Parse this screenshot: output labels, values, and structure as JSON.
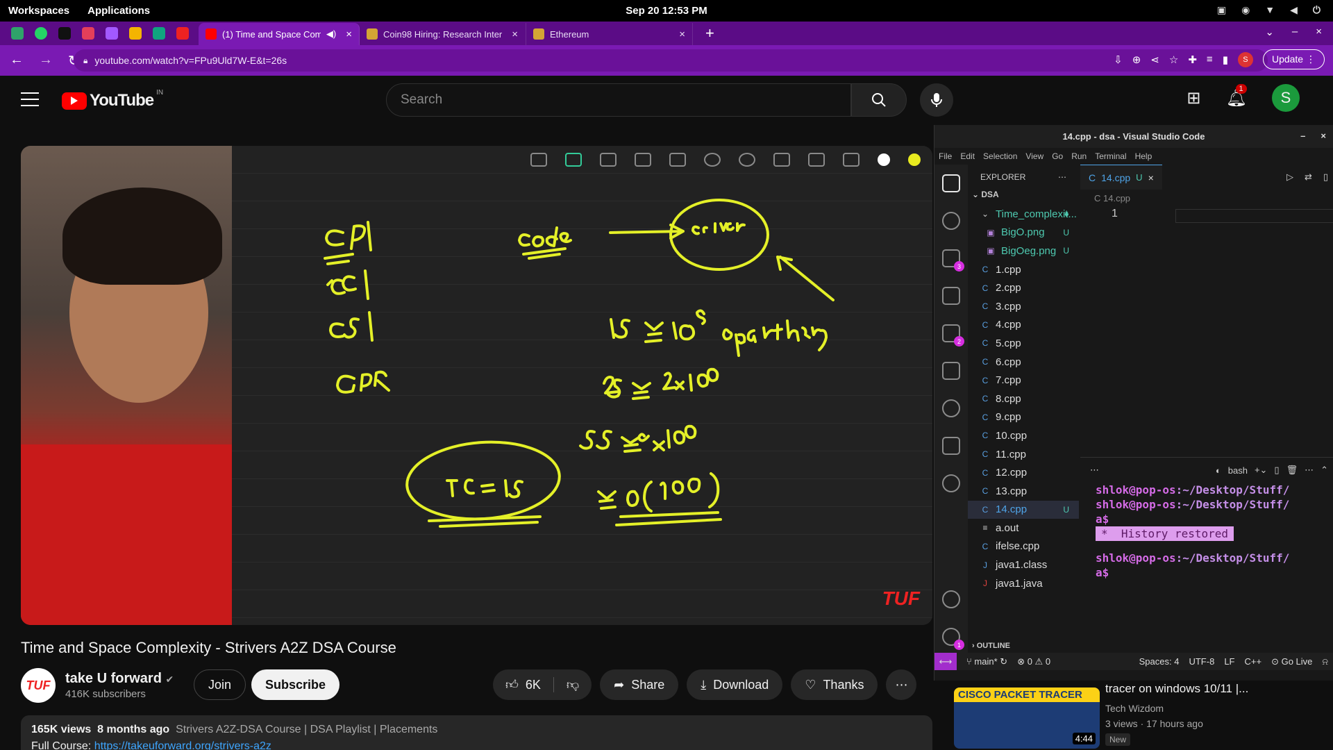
{
  "desktop": {
    "workspaces": "Workspaces",
    "applications": "Applications",
    "datetime": "Sep 20  12:53 PM"
  },
  "browser": {
    "tabs": [
      {
        "title": "(1) Time and Space Compl",
        "favicon": "youtube-icon",
        "active": true
      },
      {
        "title": "Coin98 Hiring: Research Inter",
        "favicon": "coin98-icon",
        "active": false
      },
      {
        "title": "Ethereum",
        "favicon": "coin98-icon",
        "active": false
      }
    ],
    "url": "youtube.com/watch?v=FPu9Uld7W-E&t=26s",
    "update_label": "Update",
    "profile_initial": "S",
    "accent": "#7a1ab3"
  },
  "youtube": {
    "logo_text": "YouTube",
    "country": "IN",
    "search_placeholder": "Search",
    "notifications": "1",
    "avatar_initial": "S",
    "video": {
      "title": "Time and Space Complexity - Strivers A2Z DSA Course",
      "watermark": "TUF"
    },
    "channel": {
      "name": "take U forward",
      "subscribers": "416K subscribers",
      "avatar_text": "TUF"
    },
    "join": "Join",
    "subscribe": "Subscribe",
    "likes": "6K",
    "share": "Share",
    "download": "Download",
    "thanks": "Thanks",
    "description": {
      "views": "165K views",
      "age": "8 months ago",
      "tags": "Strivers A2Z-DSA Course | DSA Playlist | Placements",
      "full_course_label": "Full Course:",
      "link": "https://takeuforward.org/strivers-a2z"
    },
    "recommendation": {
      "thumb_text": "CISCO PACKET TRACER",
      "duration": "4:44",
      "title": "tracer on windows 10/11 |...",
      "channel": "Tech Wizdom",
      "meta": "3 views  ·  17 hours ago",
      "badge": "New"
    }
  },
  "vscode": {
    "window_title": "14.cpp - dsa - Visual Studio Code",
    "menu": [
      "File",
      "Edit",
      "Selection",
      "View",
      "Go",
      "Run",
      "Terminal",
      "Help"
    ],
    "explorer_label": "EXPLORER",
    "root_folder": "DSA",
    "files": [
      {
        "name": "Time_complexit...",
        "icon": "folder-open",
        "badge": "●",
        "indent": 1
      },
      {
        "name": "BigO.png",
        "icon": "image",
        "badge": "U",
        "indent": 2
      },
      {
        "name": "BigOeg.png",
        "icon": "image",
        "badge": "U",
        "indent": 2
      },
      {
        "name": "1.cpp",
        "icon": "cpp",
        "badge": "",
        "indent": 1
      },
      {
        "name": "2.cpp",
        "icon": "cpp",
        "badge": "",
        "indent": 1
      },
      {
        "name": "3.cpp",
        "icon": "cpp",
        "badge": "",
        "indent": 1
      },
      {
        "name": "4.cpp",
        "icon": "cpp",
        "badge": "",
        "indent": 1
      },
      {
        "name": "5.cpp",
        "icon": "cpp",
        "badge": "",
        "indent": 1
      },
      {
        "name": "6.cpp",
        "icon": "cpp",
        "badge": "",
        "indent": 1
      },
      {
        "name": "7.cpp",
        "icon": "cpp",
        "badge": "",
        "indent": 1
      },
      {
        "name": "8.cpp",
        "icon": "cpp",
        "badge": "",
        "indent": 1
      },
      {
        "name": "9.cpp",
        "icon": "cpp",
        "badge": "",
        "indent": 1
      },
      {
        "name": "10.cpp",
        "icon": "cpp",
        "badge": "",
        "indent": 1
      },
      {
        "name": "11.cpp",
        "icon": "cpp",
        "badge": "",
        "indent": 1
      },
      {
        "name": "12.cpp",
        "icon": "cpp",
        "badge": "",
        "indent": 1
      },
      {
        "name": "13.cpp",
        "icon": "cpp",
        "badge": "",
        "indent": 1
      },
      {
        "name": "14.cpp",
        "icon": "cpp",
        "badge": "U",
        "indent": 1,
        "selected": true
      },
      {
        "name": "a.out",
        "icon": "binary",
        "badge": "",
        "indent": 1
      },
      {
        "name": "ifelse.cpp",
        "icon": "cpp",
        "badge": "",
        "indent": 1
      },
      {
        "name": "java1.class",
        "icon": "java-class",
        "badge": "",
        "indent": 1
      },
      {
        "name": "java1.java",
        "icon": "java",
        "badge": "",
        "indent": 1
      }
    ],
    "outline_label": "OUTLINE",
    "editor_tab": "14.cpp",
    "editor_tab_badge": "U",
    "breadcrumb": "14.cpp",
    "line_number": "1",
    "terminal_name": "bash",
    "terminal_lines": [
      {
        "prompt": "shlok@pop-os",
        "path": ":~/Desktop/Stuff/"
      },
      {
        "prompt": "shlok@pop-os",
        "path": ":~/Desktop/Stuff/"
      },
      {
        "prompt": "a$",
        "path": ""
      }
    ],
    "history_restored": "History restored",
    "history_prefix": "*",
    "terminal_lines_after": [
      {
        "prompt": "shlok@pop-os",
        "path": ":~/Desktop/Stuff/"
      },
      {
        "prompt": "a$",
        "path": ""
      }
    ],
    "activity_badges": {
      "source_control": "3",
      "extensions": "2",
      "settings": "1"
    },
    "status": {
      "branch": "main*",
      "errors": "0",
      "warnings": "0",
      "spaces": "Spaces: 4",
      "encoding": "UTF-8",
      "eol": "LF",
      "language": "C++",
      "golive": "Go Live"
    }
  }
}
